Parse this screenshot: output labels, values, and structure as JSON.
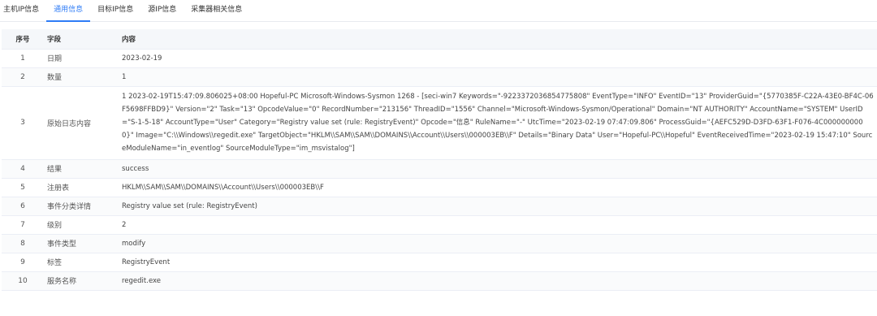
{
  "tabs": [
    {
      "label": "主机IP信息",
      "active": false
    },
    {
      "label": "通用信息",
      "active": true
    },
    {
      "label": "目标IP信息",
      "active": false
    },
    {
      "label": "源IP信息",
      "active": false
    },
    {
      "label": "采集器相关信息",
      "active": false
    }
  ],
  "table": {
    "headers": {
      "index": "序号",
      "field": "字段",
      "content": "内容"
    },
    "rows": [
      {
        "index": "1",
        "field": "日期",
        "content": "2023-02-19"
      },
      {
        "index": "2",
        "field": "数量",
        "content": "1"
      },
      {
        "index": "3",
        "field": "原始日志内容",
        "content": "1 2023-02-19T15:47:09.806025+08:00 Hopeful-PC Microsoft-Windows-Sysmon 1268 - [seci-win7 Keywords=\"-9223372036854775808\" EventType=\"INFO\" EventID=\"13\" ProviderGuid=\"{5770385F-C22A-43E0-BF4C-06F5698FFBD9}\" Version=\"2\" Task=\"13\" OpcodeValue=\"0\" RecordNumber=\"213156\" ThreadID=\"1556\" Channel=\"Microsoft-Windows-Sysmon/Operational\" Domain=\"NT AUTHORITY\" AccountName=\"SYSTEM\" UserID=\"S-1-5-18\" AccountType=\"User\" Category=\"Registry value set (rule: RegistryEvent)\" Opcode=\"信息\" RuleName=\"-\" UtcTime=\"2023-02-19 07:47:09.806\" ProcessGuid=\"{AEFC529D-D3FD-63F1-F076-4C0000000000}\" Image=\"C:\\\\Windows\\\\regedit.exe\" TargetObject=\"HKLM\\\\SAM\\\\SAM\\\\DOMAINS\\\\Account\\\\Users\\\\000003EB\\\\F\" Details=\"Binary Data\" User=\"Hopeful-PC\\\\Hopeful\" EventReceivedTime=\"2023-02-19 15:47:10\" SourceModuleName=\"in_eventlog\" SourceModuleType=\"im_msvistalog\"]"
      },
      {
        "index": "4",
        "field": "结果",
        "content": "success"
      },
      {
        "index": "5",
        "field": "注册表",
        "content": "HKLM\\\\SAM\\\\SAM\\\\DOMAINS\\\\Account\\\\Users\\\\000003EB\\\\F"
      },
      {
        "index": "6",
        "field": "事件分类详情",
        "content": "Registry value set (rule: RegistryEvent)"
      },
      {
        "index": "7",
        "field": "级别",
        "content": "2"
      },
      {
        "index": "8",
        "field": "事件类型",
        "content": "modify"
      },
      {
        "index": "9",
        "field": "标签",
        "content": "RegistryEvent"
      },
      {
        "index": "10",
        "field": "服务名称",
        "content": "regedit.exe"
      }
    ]
  },
  "colors": {
    "accent": "#2f7cf6",
    "header_bg": "#f5f7fa",
    "border": "#ebeef5"
  }
}
